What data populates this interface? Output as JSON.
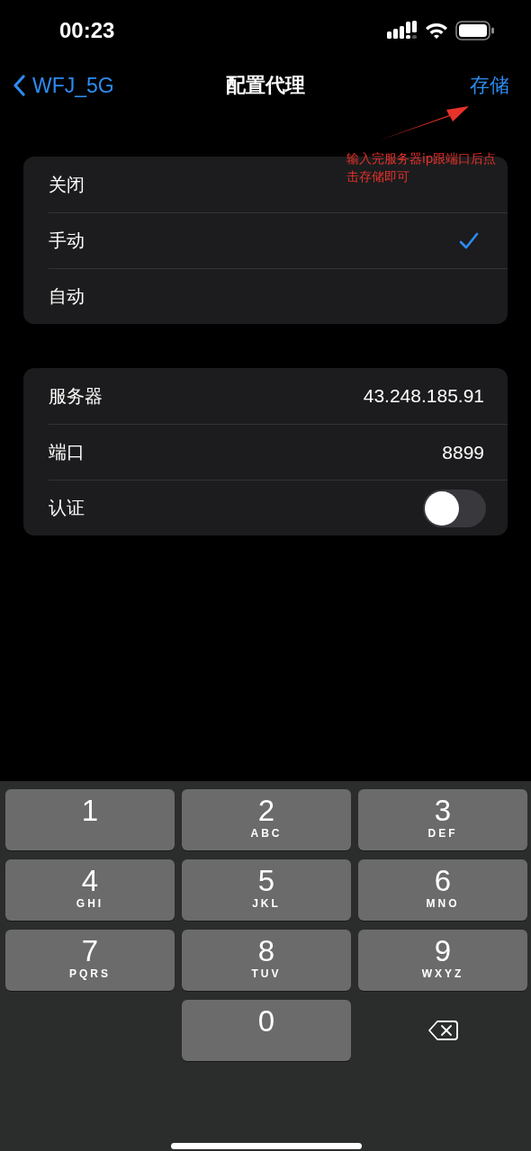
{
  "status_bar": {
    "time": "00:23"
  },
  "nav": {
    "back": "WFJ_5G",
    "title": "配置代理",
    "action": "存储"
  },
  "annotation": {
    "text": "输入完服务器ip跟端口后点击存储即可"
  },
  "proxy_modes": [
    {
      "label": "关闭",
      "selected": false
    },
    {
      "label": "手动",
      "selected": true
    },
    {
      "label": "自动",
      "selected": false
    }
  ],
  "settings": [
    {
      "kind": "value",
      "label": "服务器",
      "value": "43.248.185.91"
    },
    {
      "kind": "value",
      "label": "端口",
      "value": "8899"
    },
    {
      "kind": "toggle",
      "label": "认证",
      "on": false
    }
  ],
  "keypad": [
    {
      "kind": "digit",
      "digit": "1"
    },
    {
      "kind": "digit",
      "digit": "2",
      "letters": "ABC"
    },
    {
      "kind": "digit",
      "digit": "3",
      "letters": "DEF"
    },
    {
      "kind": "digit",
      "digit": "4",
      "letters": "GHI"
    },
    {
      "kind": "digit",
      "digit": "5",
      "letters": "JKL"
    },
    {
      "kind": "digit",
      "digit": "6",
      "letters": "MNO"
    },
    {
      "kind": "digit",
      "digit": "7",
      "letters": "PQRS"
    },
    {
      "kind": "digit",
      "digit": "8",
      "letters": "TUV"
    },
    {
      "kind": "digit",
      "digit": "9",
      "letters": "WXYZ"
    },
    {
      "kind": "blank"
    },
    {
      "kind": "digit",
      "digit": "0"
    },
    {
      "kind": "delete"
    }
  ]
}
